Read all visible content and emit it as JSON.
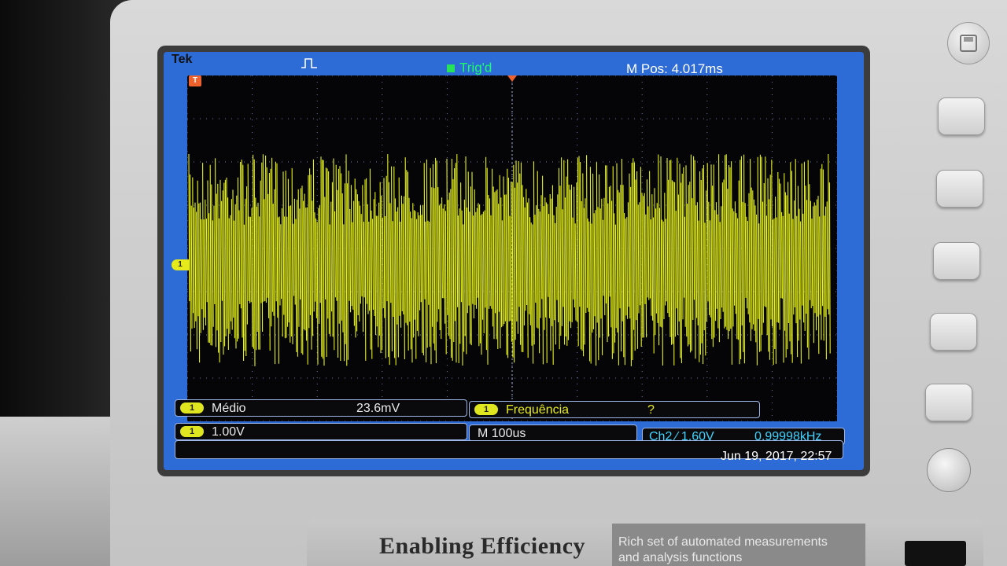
{
  "header": {
    "brand": "Tek",
    "trigger_status": "Trig'd",
    "m_pos": "M Pos: 4.017ms"
  },
  "markers": {
    "channel": "1",
    "trigger": "T"
  },
  "measurements": {
    "mean": {
      "channel": "1",
      "label": "Médio",
      "value": "23.6mV"
    },
    "frequency": {
      "channel": "1",
      "label": "Frequência",
      "value": "?"
    }
  },
  "status": {
    "ch1_scale_channel": "1",
    "ch1_scale": "1.00V",
    "timebase": "M 100us",
    "trigger_setting": "Ch2 ⁄ 1.60V",
    "trigger_freq": "0.99998kHz",
    "datetime": "Jun 19, 2017, 22:57"
  },
  "bezel": {
    "slogan": "Enabling Efficiency",
    "tagline_1": "Rich set of automated measurements",
    "tagline_2": "and analysis functions"
  },
  "colors": {
    "screen_bg": "#2d6bd6",
    "trace": "#e6f21a",
    "trig_green": "#27e35a",
    "trigger_marker": "#f0622d"
  },
  "icons": [
    "save-icon",
    "pulse-icon",
    "knob-icon"
  ]
}
